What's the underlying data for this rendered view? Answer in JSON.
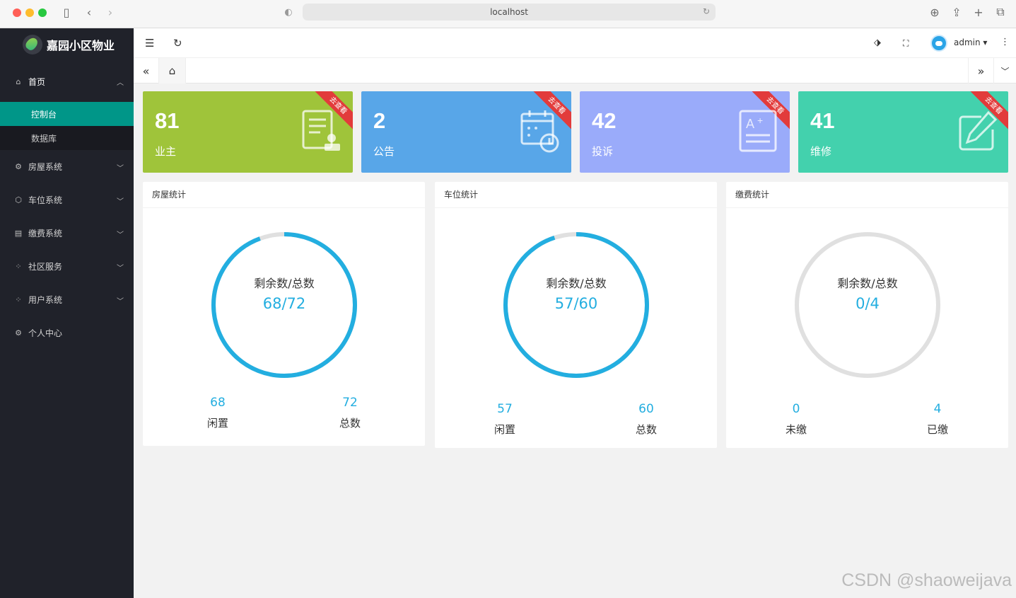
{
  "browser": {
    "url": "localhost"
  },
  "sidebar": {
    "logo": "嘉园小区物业",
    "home": {
      "label": "首页",
      "submenu": [
        "控制台",
        "数据库"
      ]
    },
    "items": [
      {
        "label": "房屋系统",
        "icon": "gear-icon"
      },
      {
        "label": "车位系统",
        "icon": "cube-icon"
      },
      {
        "label": "缴费系统",
        "icon": "list-icon"
      },
      {
        "label": "社区服务",
        "icon": "apps-icon"
      },
      {
        "label": "用户系统",
        "icon": "apps-icon"
      },
      {
        "label": "个人中心",
        "icon": "gear-icon"
      }
    ]
  },
  "header": {
    "username": "admin"
  },
  "stats": [
    {
      "value": "81",
      "label": "业主",
      "ribbon": "去查看",
      "color": "#9fc43a"
    },
    {
      "value": "2",
      "label": "公告",
      "ribbon": "去查看",
      "color": "#58a6e8"
    },
    {
      "value": "42",
      "label": "投诉",
      "ribbon": "去查看",
      "color": "#9aabfa"
    },
    {
      "value": "41",
      "label": "维修",
      "ribbon": "去查看",
      "color": "#43d1ad"
    }
  ],
  "panels": [
    {
      "title": "房屋统计",
      "ring_label": "剩余数/总数",
      "ring_value": "68/72",
      "progress": 0.944,
      "left_num": "68",
      "left_label": "闲置",
      "right_num": "72",
      "right_label": "总数"
    },
    {
      "title": "车位统计",
      "ring_label": "剩余数/总数",
      "ring_value": "57/60",
      "progress": 0.95,
      "left_num": "57",
      "left_label": "闲置",
      "right_num": "60",
      "right_label": "总数"
    },
    {
      "title": "缴费统计",
      "ring_label": "剩余数/总数",
      "ring_value": "0/4",
      "progress": 0,
      "left_num": "0",
      "left_label": "未缴",
      "right_num": "4",
      "right_label": "已缴"
    }
  ],
  "colors": {
    "accent": "#009688",
    "ring": "#23aee0",
    "ring_track": "#e0e0e0",
    "sidebar": "#20222a"
  },
  "watermark": "CSDN @shaoweijava"
}
